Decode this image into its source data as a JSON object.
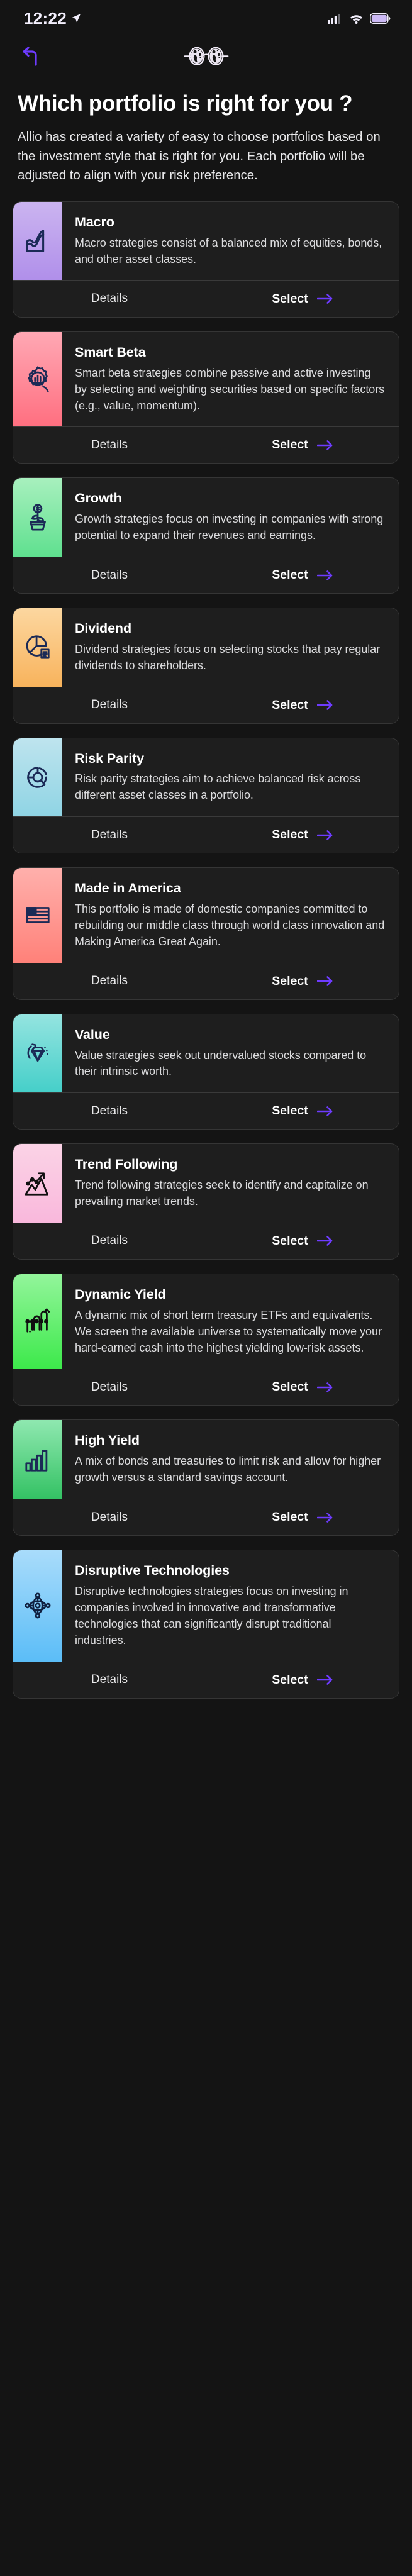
{
  "status_bar": {
    "time": "12:22",
    "location_icon": "location-arrow-icon",
    "cellular_icon": "cellular-signal-icon",
    "wifi_icon": "wifi-icon",
    "battery_icon": "battery-icon"
  },
  "nav": {
    "back_icon": "back-arrow-icon",
    "logo_icon": "globe-glasses-logo-icon",
    "accent": "#6E3BFF"
  },
  "header": {
    "title": "Which portfolio is right for you ?",
    "subtitle": "Allio has created a variety of easy to choose portfolios based on the investment style that is right for you. Each portfolio will be adjusted to align with your risk preference."
  },
  "footer_labels": {
    "details": "Details",
    "select": "Select",
    "select_arrow_icon": "arrow-right-icon"
  },
  "portfolios": [
    {
      "name": "Macro",
      "description": "Macro strategies consist of a balanced mix of equities, bonds, and other asset classes.",
      "icon": "wave-chart-icon",
      "gradient_from": "#CBB4F0",
      "gradient_to": "#B08FEA",
      "icon_color": "#1B2A56"
    },
    {
      "name": "Smart Beta",
      "description": "Smart beta strategies combine passive and active investing by selecting and weighting securities based on specific factors (e.g., value, momentum).",
      "icon": "gear-bar-chart-icon",
      "gradient_from": "#FFA8B4",
      "gradient_to": "#FF6F80",
      "icon_color": "#1B2A56"
    },
    {
      "name": "Growth",
      "description": "Growth strategies focus on investing in companies with strong potential to expand their revenues and earnings.",
      "icon": "money-plant-icon",
      "gradient_from": "#A8F0BE",
      "gradient_to": "#5FE08F",
      "icon_color": "#1B2A56"
    },
    {
      "name": "Dividend",
      "description": "Dividend strategies focus on selecting stocks that pay regular dividends to shareholders.",
      "icon": "pie-chart-document-icon",
      "gradient_from": "#FCD7A0",
      "gradient_to": "#F8B35C",
      "icon_color": "#1B2A56"
    },
    {
      "name": "Risk Parity",
      "description": "Risk parity strategies aim to achieve balanced risk across different asset classes in a portfolio.",
      "icon": "donut-segments-icon",
      "gradient_from": "#BEE4EE",
      "gradient_to": "#8FD4E4",
      "icon_color": "#1B2A56"
    },
    {
      "name": "Made in America",
      "description": "This portfolio is made of domestic companies committed to rebuilding our middle class through world class innovation and Making America Great Again.",
      "icon": "american-flag-icon",
      "gradient_from": "#FFB0AC",
      "gradient_to": "#FF8179",
      "icon_color": "#1B2A56"
    },
    {
      "name": "Value",
      "description": "Value strategies seek out undervalued stocks compared to their intrinsic worth.",
      "icon": "diamond-gem-icon",
      "gradient_from": "#94E4E0",
      "gradient_to": "#45CFC9",
      "icon_color": "#1B2A56"
    },
    {
      "name": "Trend Following",
      "description": "Trend following strategies seek to identify and capitalize on prevailing market trends.",
      "icon": "mountain-trend-arrow-icon",
      "gradient_from": "#FBD3E6",
      "gradient_to": "#F9B8DC",
      "icon_color": "#101010"
    },
    {
      "name": "Dynamic Yield",
      "description": "A dynamic mix of short term treasury ETFs and equivalents. We screen the available universe to systematically move your hard-earned cash into the highest yielding low-risk assets.",
      "icon": "bouncing-arrows-icon",
      "gradient_from": "#93F59B",
      "gradient_to": "#3DE94B",
      "icon_color": "#101010"
    },
    {
      "name": "High Yield",
      "description": "A mix of bonds and treasuries to limit risk and allow for higher growth versus a standard savings account.",
      "icon": "ascending-bars-icon",
      "gradient_from": "#8FE8B0",
      "gradient_to": "#34C264",
      "icon_color": "#1B2A56"
    },
    {
      "name": "Disruptive Technologies",
      "description": "Disruptive technologies strategies focus on investing in companies involved in innovative and transformative technologies that can significantly disrupt traditional industries.",
      "icon": "atom-molecule-icon",
      "gradient_from": "#A9DCFB",
      "gradient_to": "#5BBDF7",
      "icon_color": "#102040"
    }
  ]
}
